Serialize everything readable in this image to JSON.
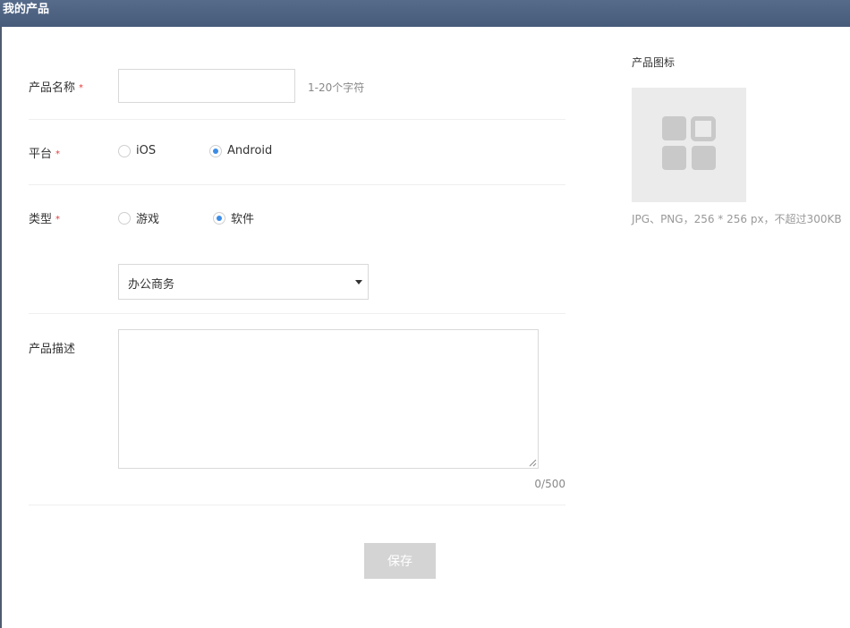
{
  "window": {
    "title": "我的产品"
  },
  "form": {
    "name": {
      "label": "产品名称",
      "required_mark": "*",
      "value": "",
      "placeholder": "",
      "hint": "1-20个字符"
    },
    "platform": {
      "label": "平台",
      "required_mark": "*",
      "options": [
        {
          "label": "iOS",
          "checked": false
        },
        {
          "label": "Android",
          "checked": true
        }
      ]
    },
    "type": {
      "label": "类型",
      "required_mark": "*",
      "options": [
        {
          "label": "游戏",
          "checked": false
        },
        {
          "label": "软件",
          "checked": true
        }
      ],
      "category_selected": "办公商务"
    },
    "description": {
      "label": "产品描述",
      "value": "",
      "counter": "0/500"
    },
    "save_label": "保存"
  },
  "icon_upload": {
    "label": "产品图标",
    "hint": "JPG、PNG，256 * 256 px，不超过300KB",
    "placeholder_icon": "app-grid-icon"
  },
  "colors": {
    "titlebar": "#4f6483",
    "accent": "#3c8ce7",
    "required": "#e4393c",
    "button_disabled": "#d4d4d4"
  }
}
